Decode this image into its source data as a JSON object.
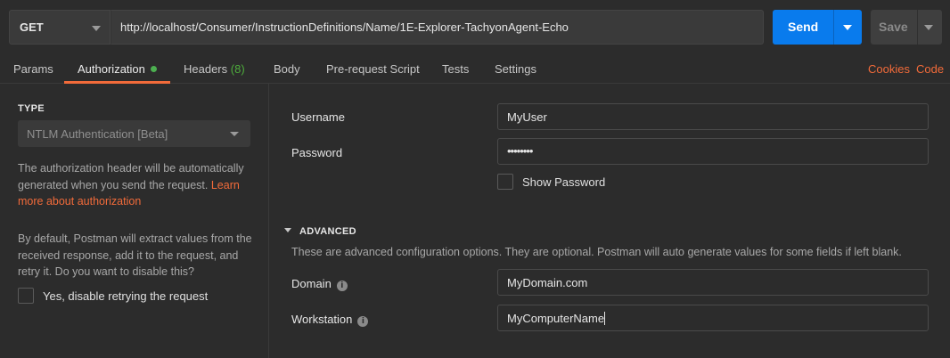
{
  "request": {
    "method": "GET",
    "url": "http://localhost/Consumer/InstructionDefinitions/Name/1E-Explorer-TachyonAgent-Echo",
    "send_label": "Send",
    "save_label": "Save"
  },
  "tabs": {
    "params": "Params",
    "authorization": "Authorization",
    "headers": "Headers",
    "headers_count": "(8)",
    "body": "Body",
    "prerequest": "Pre-request Script",
    "tests": "Tests",
    "settings": "Settings",
    "cookies": "Cookies",
    "code": "Code"
  },
  "left": {
    "type_label": "TYPE",
    "auth_type": "NTLM Authentication [Beta]",
    "desc1_text": "The authorization header will be automatically generated when you send the request.",
    "desc1_link": "Learn more about authorization",
    "desc2_text": "By default, Postman will extract values from the received response, add it to the request, and retry it. Do you want to disable this?",
    "disable_retry_label": "Yes, disable retrying the request"
  },
  "form": {
    "username_label": "Username",
    "username_value": "MyUser",
    "password_label": "Password",
    "password_value": "••••••••",
    "show_password_label": "Show Password",
    "advanced_label": "ADVANCED",
    "advanced_desc": "These are advanced configuration options. They are optional. Postman will auto generate values for some fields if left blank.",
    "domain_label": "Domain",
    "domain_value": "MyDomain.com",
    "workstation_label": "Workstation",
    "workstation_value": "MyComputerName"
  },
  "colors": {
    "accent": "#f26b3a",
    "send": "#097bed",
    "status_dot": "#4caf50",
    "headers_count": "#4dab3c"
  },
  "icons": {
    "method_dropdown": "chevron-down-icon",
    "send_dropdown": "chevron-down-icon",
    "save_dropdown": "chevron-down-icon",
    "auth_status": "status-dot-icon",
    "info": "info-icon",
    "advanced_toggle": "triangle-down-icon"
  }
}
